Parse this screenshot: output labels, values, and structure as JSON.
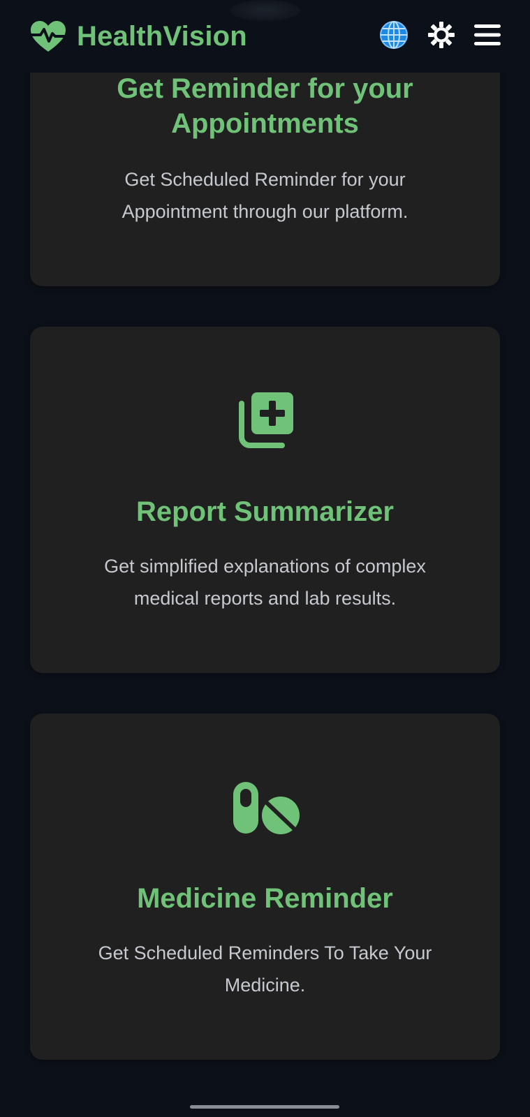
{
  "app": {
    "name": "HealthVision",
    "accent_color": "#6fc277",
    "background_color": "#0c1018",
    "card_color": "#202020"
  },
  "header": {
    "logo_icon": "heart-pulse-icon",
    "actions": [
      {
        "name": "language",
        "icon": "globe-icon"
      },
      {
        "name": "theme",
        "icon": "sun-icon"
      },
      {
        "name": "menu",
        "icon": "hamburger-menu-icon"
      }
    ]
  },
  "cards": [
    {
      "title": "Get Reminder for your Appointments",
      "description": "Get Scheduled Reminder for your Appointment through our platform.",
      "icon": "calendar-icon"
    },
    {
      "title": "Report Summarizer",
      "description": "Get simplified explanations of complex medical reports and lab results.",
      "icon": "medical-report-icon"
    },
    {
      "title": "Medicine Reminder",
      "description": "Get Scheduled Reminders To Take Your Medicine.",
      "icon": "pills-icon"
    }
  ]
}
